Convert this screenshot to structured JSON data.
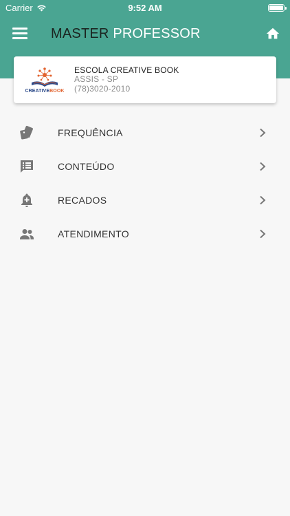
{
  "status_bar": {
    "carrier": "Carrier",
    "time": "9:52 AM"
  },
  "header": {
    "title_part1": "MASTER",
    "title_part2": "PROFESSOR",
    "menu_icon": "hamburger-menu-icon",
    "home_icon": "home-icon"
  },
  "school": {
    "logo_text_part1": "CREATIVE",
    "logo_text_part2": "BOOK",
    "name": "ESCOLA CREATIVE BOOK",
    "city": "ASSIS - SP",
    "phone": "(78)3020-2010"
  },
  "menu": {
    "items": [
      {
        "label": "FREQUÊNCIA",
        "icon": "tags-icon"
      },
      {
        "label": "CONTEÚDO",
        "icon": "message-list-icon"
      },
      {
        "label": "RECADOS",
        "icon": "notification-add-icon"
      },
      {
        "label": "ATENDIMENTO",
        "icon": "people-icon"
      }
    ]
  },
  "colors": {
    "primary": "#4aa592",
    "icon_gray": "#777777",
    "background": "#f7f7f7"
  }
}
